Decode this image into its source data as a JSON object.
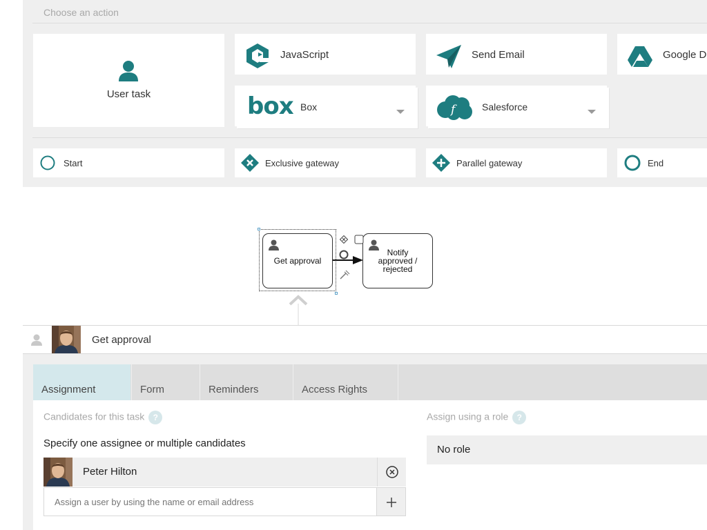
{
  "palette": {
    "choose_action": "Choose an action",
    "cards": {
      "user_task": "User task",
      "javascript": "JavaScript",
      "send_email": "Send Email",
      "google_drive": "Google Dr",
      "box": "Box",
      "salesforce": "Salesforce",
      "box_logo_text": "box"
    },
    "elements": {
      "start": "Start",
      "exclusive_gateway": "Exclusive gateway",
      "parallel_gateway": "Parallel gateway",
      "end": "End"
    }
  },
  "diagram": {
    "nodes": [
      {
        "id": "get-approval",
        "lines": [
          "Get approval"
        ]
      },
      {
        "id": "notify",
        "lines": [
          "Notify",
          "approved /",
          "rejected"
        ]
      }
    ]
  },
  "task": {
    "title": "Get approval",
    "tabs": [
      "Assignment",
      "Form",
      "Reminders",
      "Access Rights"
    ],
    "active_tab": "Assignment",
    "candidates_label": "Candidates for this task",
    "help_glyph": "?",
    "specify_label": "Specify one assignee or multiple candidates",
    "assignees": [
      "Peter Hilton"
    ],
    "assign_placeholder": "Assign a user by using the name or email address",
    "role_label": "Assign using a role",
    "role_value": "No role"
  },
  "colors": {
    "accent": "#1e7d80",
    "panel_bg": "#efefef",
    "active_tab": "#d4e8ec"
  }
}
